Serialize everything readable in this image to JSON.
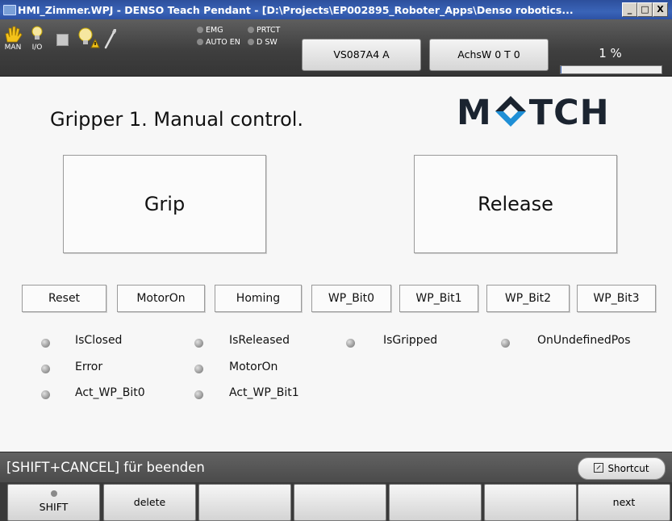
{
  "window": {
    "title": "HMI_Zimmer.WPJ - DENSO Teach Pendant - [D:\\Projects\\EP002895_Roboter_Apps\\Denso robotics...",
    "minimize": "_",
    "maximize": "□",
    "close": "X"
  },
  "toolbar": {
    "man_label": "MAN",
    "io_label": "I/O",
    "status": {
      "emg": "EMG",
      "prtct": "PRTCT",
      "auto_en": "AUTO EN",
      "dsw": "D SW"
    },
    "robot_button": "VS087A4 A",
    "axis_button": "AchsW 0 T 0",
    "progress_text": "1 %",
    "progress_value": 0.01
  },
  "main": {
    "title": "Gripper 1. Manual control.",
    "logo_left": "M",
    "logo_right": "TCH",
    "grip_button": "Grip",
    "release_button": "Release",
    "buttons": [
      "Reset",
      "MotorOn",
      "Homing",
      "WP_Bit0",
      "WP_Bit1",
      "WP_Bit2",
      "WP_Bit3"
    ],
    "indicators": [
      "IsClosed",
      "IsReleased",
      "IsGripped",
      "OnUndefinedPos",
      "Error",
      "MotorOn",
      "Act_WP_Bit0",
      "Act_WP_Bit1"
    ]
  },
  "statusbar": {
    "text": "[SHIFT+CANCEL] für beenden",
    "shortcut_label": "Shortcut"
  },
  "fkeys": [
    "SHIFT",
    "delete",
    "",
    "",
    "",
    "",
    "next"
  ]
}
